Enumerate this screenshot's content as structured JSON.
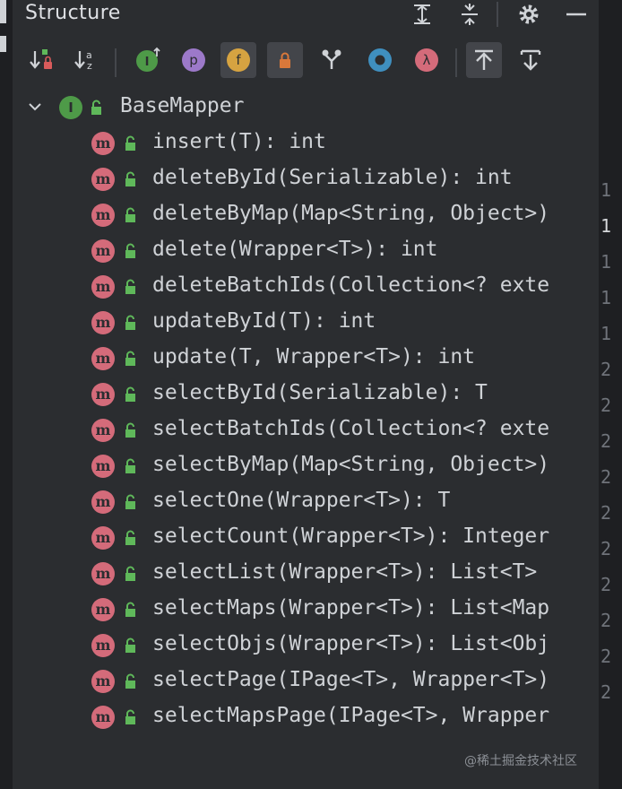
{
  "panel": {
    "title": "Structure"
  },
  "editor_line_numbers": [
    {
      "text": "1",
      "active": false
    },
    {
      "text": "1",
      "active": true
    },
    {
      "text": "1",
      "active": false
    },
    {
      "text": "1",
      "active": false
    },
    {
      "text": "1",
      "active": false
    },
    {
      "text": "2",
      "active": false
    },
    {
      "text": "2",
      "active": false
    },
    {
      "text": "2",
      "active": false
    },
    {
      "text": "2",
      "active": false
    },
    {
      "text": "2",
      "active": false
    },
    {
      "text": "2",
      "active": false
    },
    {
      "text": "2",
      "active": false
    },
    {
      "text": "2",
      "active": false
    },
    {
      "text": "2",
      "active": false
    },
    {
      "text": "2",
      "active": false
    }
  ],
  "tree": {
    "root": {
      "label": "BaseMapper",
      "badge": "I",
      "badge_color": "#4e9a48"
    },
    "methods": [
      "insert(T): int",
      "deleteById(Serializable): int",
      "deleteByMap(Map<String, Object>)",
      "delete(Wrapper<T>): int",
      "deleteBatchIds(Collection<? exte",
      "updateById(T): int",
      "update(T, Wrapper<T>): int",
      "selectById(Serializable): T",
      "selectBatchIds(Collection<? exte",
      "selectByMap(Map<String, Object>)",
      "selectOne(Wrapper<T>): T",
      "selectCount(Wrapper<T>): Integer",
      "selectList(Wrapper<T>): List<T>",
      "selectMaps(Wrapper<T>): List<Map",
      "selectObjs(Wrapper<T>): List<Obj",
      "selectPage(IPage<T>, Wrapper<T>)",
      "selectMapsPage(IPage<T>, Wrapper"
    ],
    "method_badge": "m",
    "method_badge_color": "#d46b7a"
  },
  "toolbar": {
    "badges": {
      "inherited": "I",
      "property": "p",
      "field": "f",
      "lambda": "λ"
    }
  },
  "watermark": "@稀土掘金技术社区"
}
